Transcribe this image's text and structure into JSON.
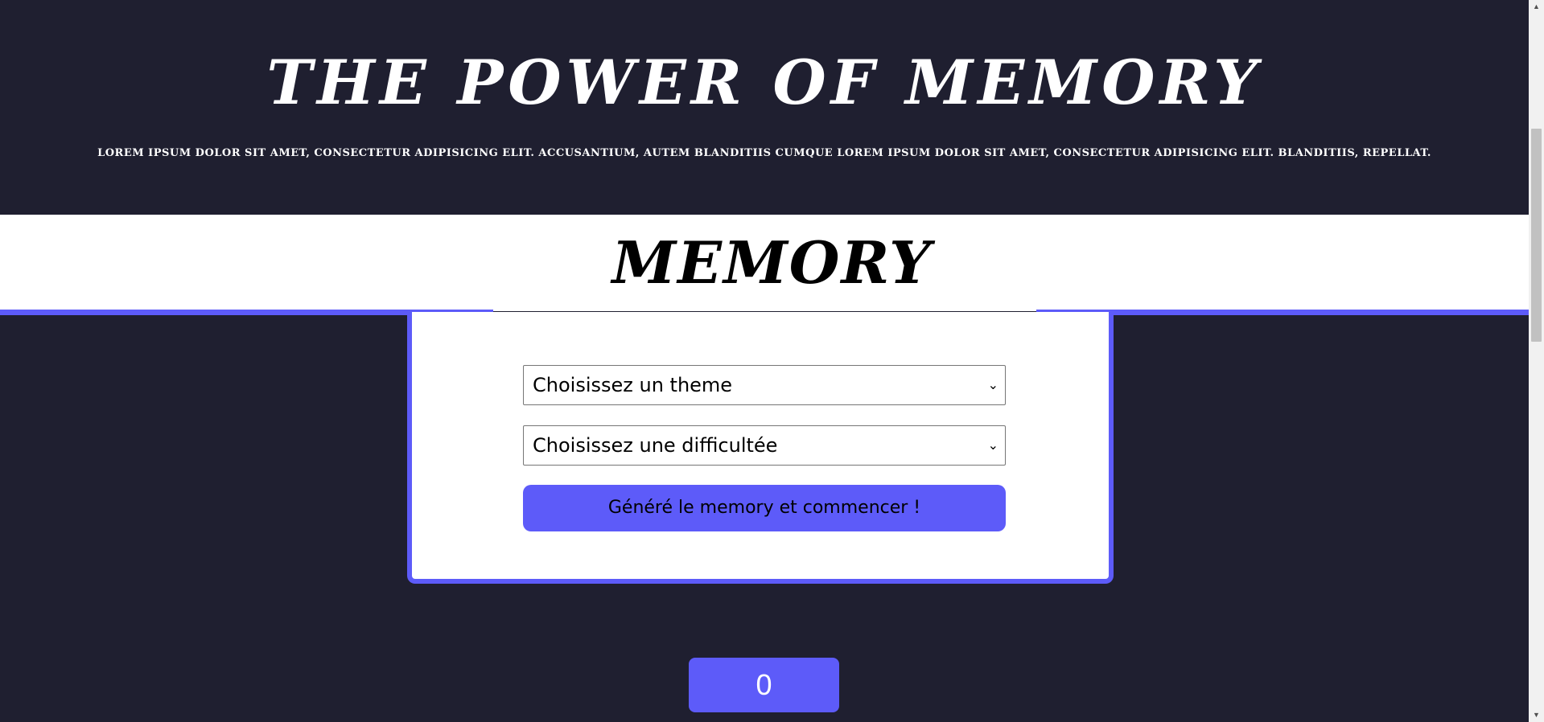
{
  "header": {
    "title": "THE POWER OF MEMORY",
    "subtitle": "Lorem ipsum dolor sit amet, consectetur adipisicing elit. Accusantium, autem blanditiis cumque Lorem ipsum dolor sit amet, consectetur adipisicing elit. Blanditiis, repellat."
  },
  "section": {
    "title": "MEMORY"
  },
  "form": {
    "theme_select": "Choisissez un theme",
    "difficulty_select": "Choisissez une difficultée",
    "generate_button": "Généré le memory et commencer !"
  },
  "score": {
    "value": "0"
  },
  "colors": {
    "background": "#1f1f30",
    "accent": "#5d5bf9",
    "surface": "#ffffff"
  },
  "icons": {
    "select_chevron": "chevron-down-icon",
    "scroll_up": "scroll-up-arrow-icon",
    "scroll_down": "scroll-down-arrow-icon"
  }
}
